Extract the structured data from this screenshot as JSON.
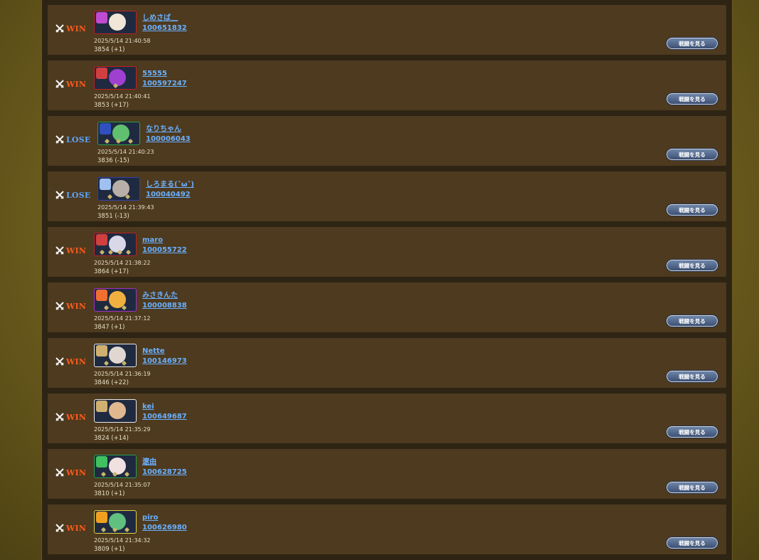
{
  "watch_label": "戦闘を見る",
  "win_color": "#ff5a1a",
  "lose_color": "#5aa6ff",
  "battles": [
    {
      "result": "WIN",
      "name": "しめさば＿",
      "id": "100651832",
      "time": "2025/5/14 21:40:58",
      "score": "3854 (+1)",
      "frame_color": "#c02020",
      "lead_color": "#c04ad0",
      "face_color": "#f0e6d8",
      "gems": 0
    },
    {
      "result": "WIN",
      "name": "55555",
      "id": "100597247",
      "time": "2025/5/14 21:40:41",
      "score": "3853 (+17)",
      "frame_color": "#c02020",
      "lead_color": "#d04040",
      "face_color": "#a040d0",
      "gems": 1
    },
    {
      "result": "LOSE",
      "name": "なりちゃん",
      "id": "100006043",
      "time": "2025/5/14 21:40:23",
      "score": "3836 (-15)",
      "frame_color": "#2aa04a",
      "lead_color": "#3050c0",
      "face_color": "#60c070",
      "gems": 3
    },
    {
      "result": "LOSE",
      "name": "しろまる(ˇωˇ)",
      "id": "100040492",
      "time": "2025/5/14 21:39:43",
      "score": "3851 (-13)",
      "frame_color": "#3040b0",
      "lead_color": "#a0c0f0",
      "face_color": "#b8b0a8",
      "gems": 2
    },
    {
      "result": "WIN",
      "name": "maro",
      "id": "100055722",
      "time": "2025/5/14 21:38:22",
      "score": "3864 (+17)",
      "frame_color": "#c02020",
      "lead_color": "#d04040",
      "face_color": "#d8d8e8",
      "gems": 4
    },
    {
      "result": "WIN",
      "name": "みさきんた",
      "id": "100008838",
      "time": "2025/5/14 21:37:12",
      "score": "3847 (+1)",
      "frame_color": "#a030c0",
      "lead_color": "#f07030",
      "face_color": "#f0b040",
      "gems": 2
    },
    {
      "result": "WIN",
      "name": "Nette",
      "id": "100146973",
      "time": "2025/5/14 21:36:19",
      "score": "3846 (+22)",
      "frame_color": "#e8e8e8",
      "lead_color": "#d0b070",
      "face_color": "#e0d8d0",
      "gems": 2
    },
    {
      "result": "WIN",
      "name": "kei",
      "id": "100649687",
      "time": "2025/5/14 21:35:29",
      "score": "3824 (+14)",
      "frame_color": "#e8e8e8",
      "lead_color": "#d0b070",
      "face_color": "#e0b890",
      "gems": 0
    },
    {
      "result": "WIN",
      "name": "遼由",
      "id": "100628725",
      "time": "2025/5/14 21:35:07",
      "score": "3810 (+1)",
      "frame_color": "#2aa04a",
      "lead_color": "#40c060",
      "face_color": "#f0e0e0",
      "gems": 3
    },
    {
      "result": "WIN",
      "name": "piro",
      "id": "100626980",
      "time": "2025/5/14 21:34:32",
      "score": "3809 (+1)",
      "frame_color": "#e0d040",
      "lead_color": "#f0a020",
      "face_color": "#60c080",
      "gems": 3
    }
  ]
}
